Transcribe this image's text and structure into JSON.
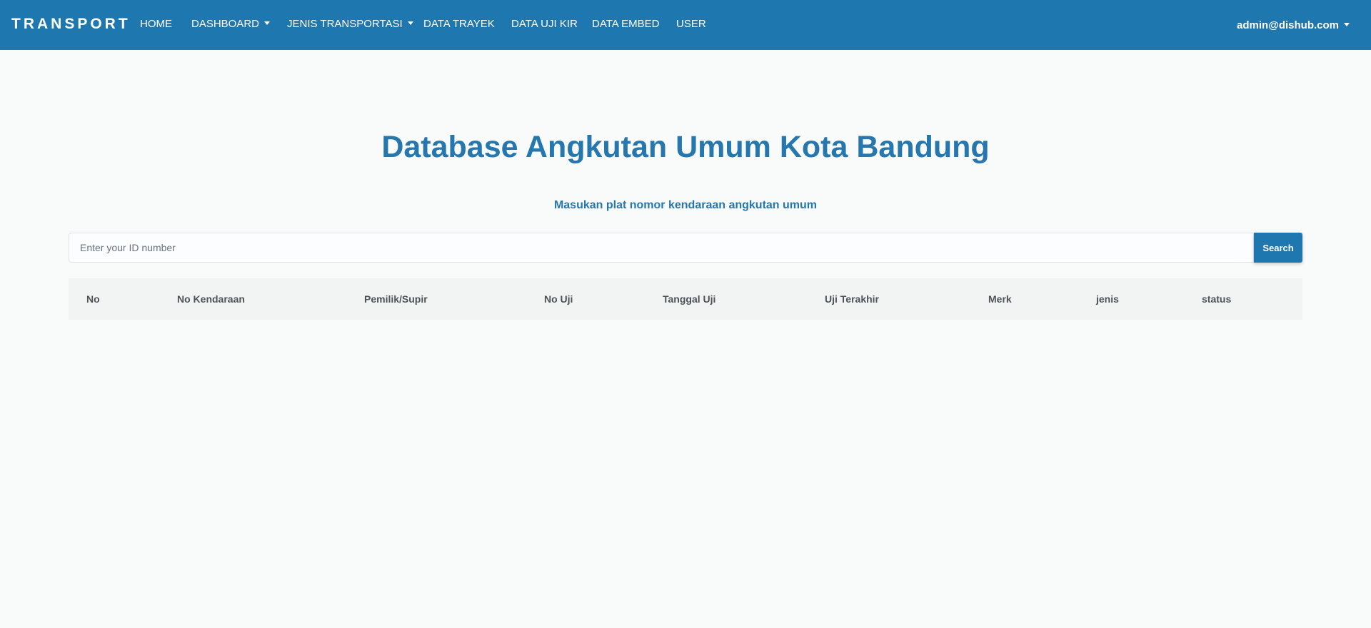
{
  "navbar": {
    "brand": "TRANSPORT",
    "items": [
      {
        "label": "HOME",
        "dropdown": false
      },
      {
        "label": "DASHBOARD",
        "dropdown": true
      },
      {
        "label": "JENIS TRANSPORTASI",
        "dropdown": true
      },
      {
        "label": "DATA TRAYEK",
        "dropdown": false
      },
      {
        "label": "DATA UJI KIR",
        "dropdown": false
      },
      {
        "label": "DATA EMBED",
        "dropdown": false
      },
      {
        "label": "USER",
        "dropdown": false
      }
    ],
    "user": "admin@dishub.com"
  },
  "main": {
    "title": "Database Angkutan Umum Kota Bandung",
    "subtitle": "Masukan plat nomor kendaraan angkutan umum",
    "search": {
      "placeholder": "Enter your ID number",
      "value": "",
      "button_label": "Search"
    },
    "table": {
      "columns": [
        "No",
        "No Kendaraan",
        "Pemilik/Supir",
        "No Uji",
        "Tanggal Uji",
        "Uji Terakhir",
        "Merk",
        "jenis",
        "status"
      ],
      "rows": []
    }
  },
  "colors": {
    "primary": "#1f77af",
    "title": "#2577ad",
    "background": "#f9fafa",
    "table_header": "#f2f3f3"
  }
}
